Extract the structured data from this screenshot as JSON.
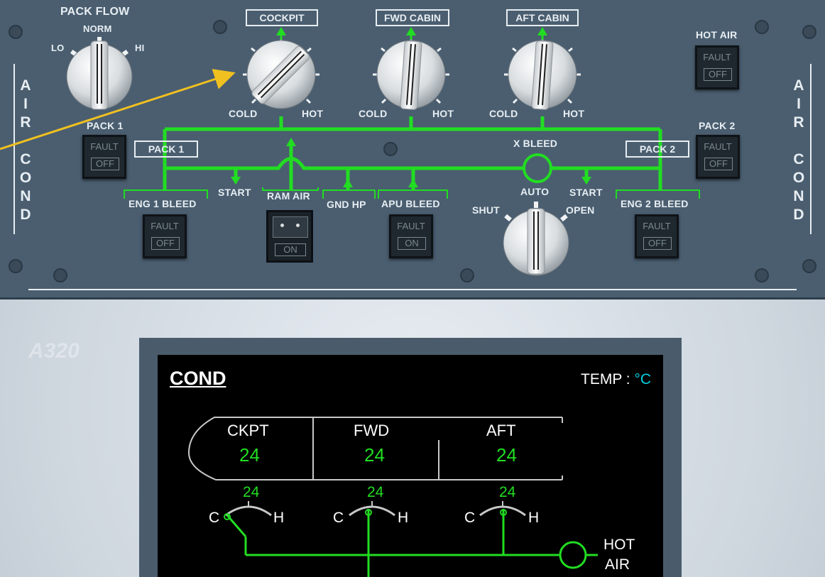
{
  "panel": {
    "side_label_left": [
      "A",
      "I",
      "R",
      "",
      "C",
      "O",
      "N",
      "D"
    ],
    "side_label_right": [
      "A",
      "I",
      "R",
      "",
      "C",
      "O",
      "N",
      "D"
    ],
    "pack_flow": {
      "title": "PACK FLOW",
      "norm": "NORM",
      "lo": "LO",
      "hi": "HI"
    },
    "zones": [
      {
        "name": "COCKPIT",
        "cold": "COLD",
        "hot": "HOT"
      },
      {
        "name": "FWD CABIN",
        "cold": "COLD",
        "hot": "HOT"
      },
      {
        "name": "AFT CABIN",
        "cold": "COLD",
        "hot": "HOT"
      }
    ],
    "hot_air": {
      "label": "HOT AIR",
      "fault": "FAULT",
      "state": "OFF"
    },
    "pack1": {
      "label": "PACK 1",
      "duct_label": "PACK 1",
      "fault": "FAULT",
      "state": "OFF"
    },
    "pack2": {
      "label": "PACK 2",
      "duct_label": "PACK 2",
      "fault": "FAULT",
      "state": "OFF"
    },
    "x_bleed": {
      "label": "X BLEED",
      "auto": "AUTO",
      "shut": "SHUT",
      "open": "OPEN"
    },
    "start_left": "START",
    "start_right": "START",
    "eng1_bleed": {
      "label": "ENG 1 BLEED",
      "fault": "FAULT",
      "state": "OFF"
    },
    "eng2_bleed": {
      "label": "ENG 2 BLEED",
      "fault": "FAULT",
      "state": "OFF"
    },
    "ram_air": {
      "label": "RAM AIR",
      "state": "ON"
    },
    "gnd_hp": "GND HP",
    "apu_bleed": {
      "label": "APU BLEED",
      "fault": "FAULT",
      "state": "ON"
    }
  },
  "ecam": {
    "title": "COND",
    "temp_label": "TEMP :",
    "temp_unit": "°C",
    "zones": [
      {
        "name": "CKPT",
        "temp": "24",
        "duct_temp": "24",
        "c": "C",
        "h": "H"
      },
      {
        "name": "FWD",
        "temp": "24",
        "duct_temp": "24",
        "c": "C",
        "h": "H"
      },
      {
        "name": "AFT",
        "temp": "24",
        "duct_temp": "24",
        "c": "C",
        "h": "H"
      }
    ],
    "hot_air_line1": "HOT",
    "hot_air_line2": "AIR"
  },
  "watermark": "A320",
  "colors": {
    "panel": "#4a5e70",
    "duct_green": "#22dd22",
    "ecam_green": "#22dd22",
    "ecam_cyan": "#00d0e0",
    "annotation_arrow": "#f0c020"
  }
}
